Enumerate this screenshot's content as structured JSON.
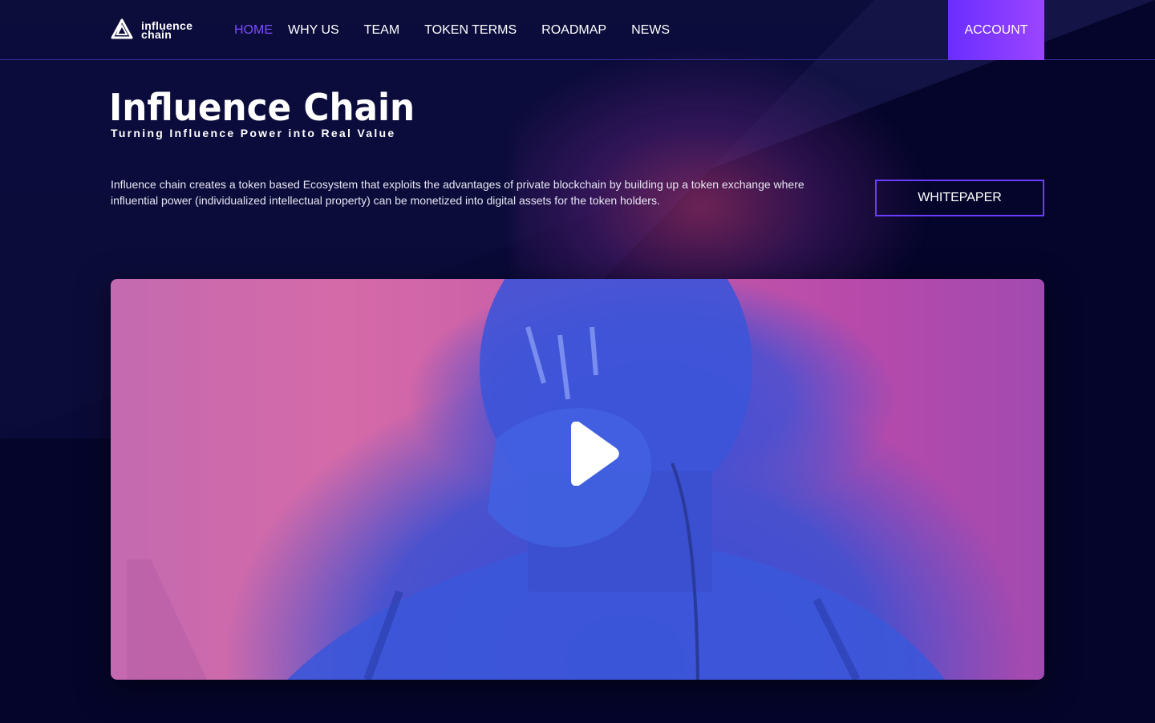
{
  "brand": {
    "logo_line1": "influence",
    "logo_line2": "chain",
    "accent": "#7a4dff",
    "button_gradient": [
      "#6a2dff",
      "#9b45ff"
    ],
    "background": "#05052b"
  },
  "nav": {
    "items": [
      {
        "label": "HOME",
        "active": true
      },
      {
        "label": "WHY US",
        "active": false
      },
      {
        "label": "TEAM",
        "active": false
      },
      {
        "label": "TOKEN TERMS",
        "active": false
      },
      {
        "label": "ROADMAP",
        "active": false
      },
      {
        "label": "NEWS",
        "active": false
      }
    ],
    "account_label": "ACCOUNT"
  },
  "hero": {
    "title": "Influence Chain",
    "subtitle": "Turning Influence Power into Real Value",
    "description": "Influence chain creates a token based Ecosystem that exploits the advantages of private blockchain by building up a token exchange where influential power (individualized intellectual property) can be monetized into digital assets for the token holders.",
    "whitepaper_label": "WHITEPAPER"
  },
  "video": {
    "play_icon": "play-icon"
  }
}
